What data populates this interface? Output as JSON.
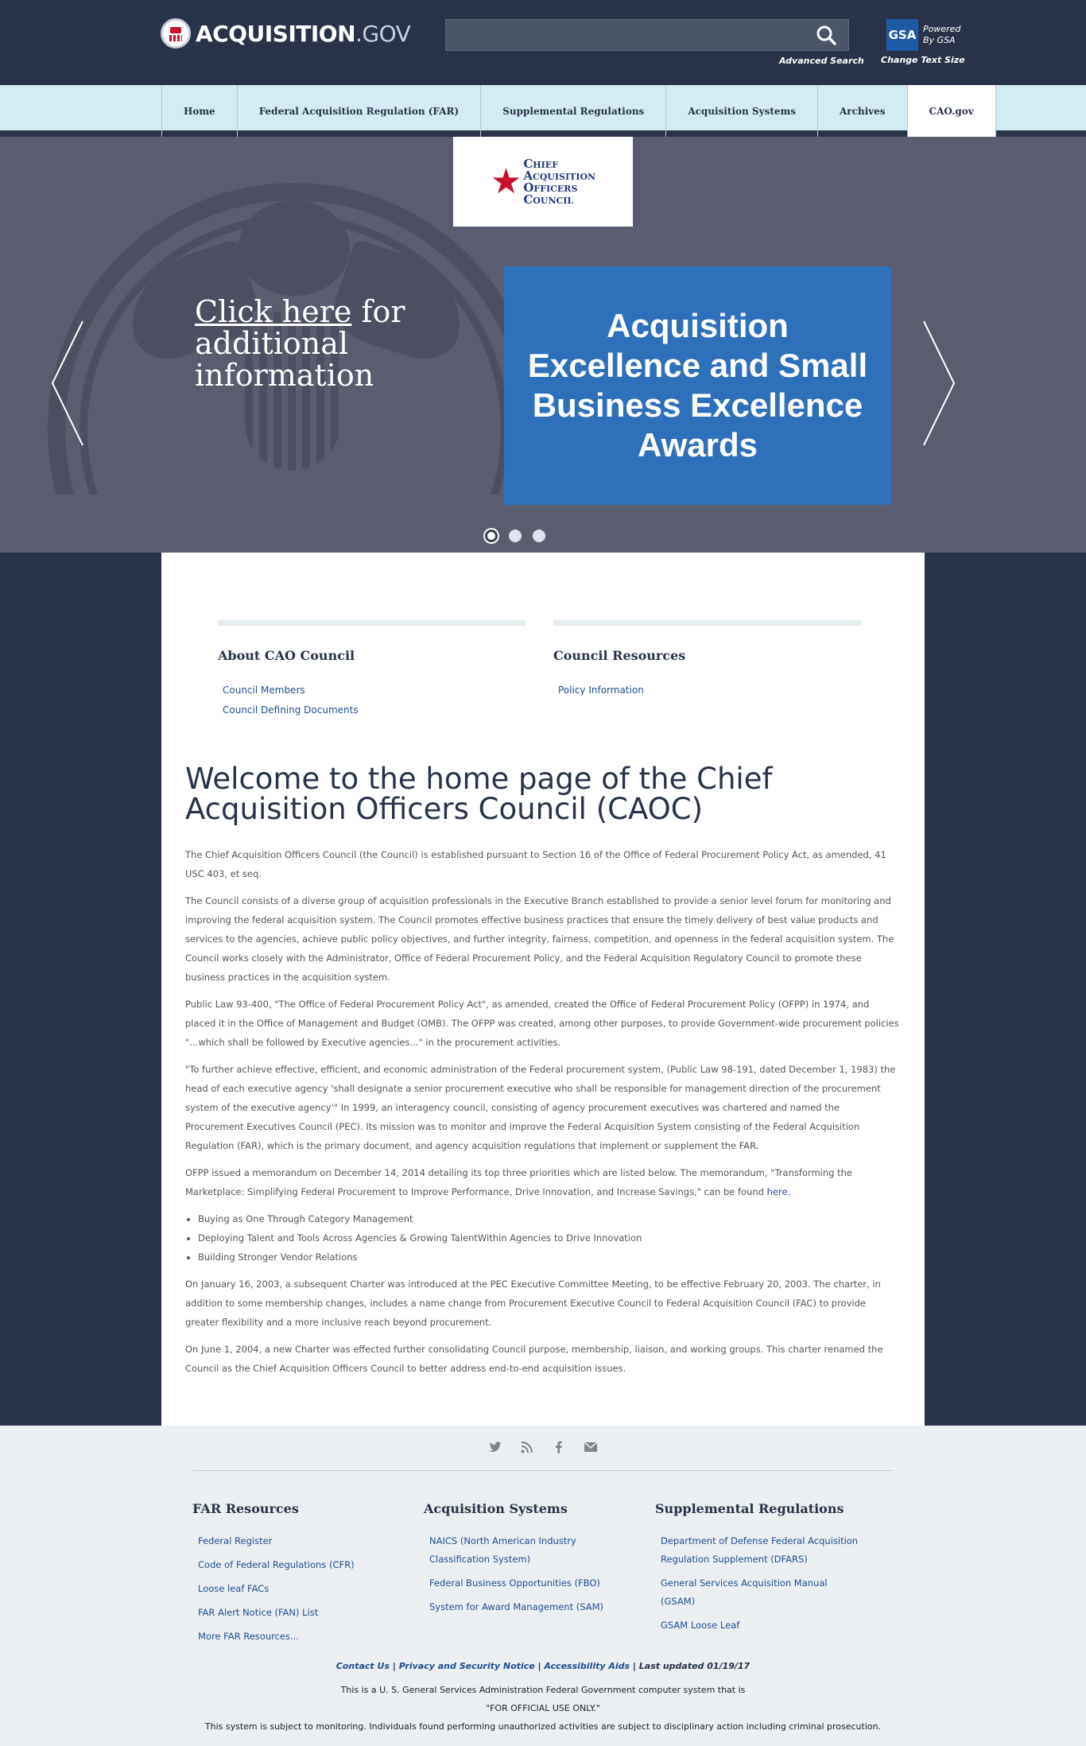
{
  "header": {
    "logo_main": "ACQUISITION",
    "logo_suffix": ".GOV",
    "search_placeholder": "",
    "advanced_search": "Advanced Search",
    "gsa_logo": "GSA",
    "powered_line1": "Powered",
    "powered_line2": "By GSA",
    "change_text_size": "Change Text Size"
  },
  "nav": {
    "items": [
      {
        "label": "Home"
      },
      {
        "label": "Federal Acquisition Regulation (FAR)"
      },
      {
        "label": "Supplemental Regulations"
      },
      {
        "label": "Acquisition Systems"
      },
      {
        "label": "Archives"
      },
      {
        "label": "CAO.gov"
      }
    ],
    "active": "CAO.gov"
  },
  "hero": {
    "cao_logo": {
      "line1": "Chief",
      "line2": "Acquisition",
      "line3": "Officers",
      "line4": "Council"
    },
    "link_text": "Click here",
    "link_rest": " for additional information",
    "award_text": "Acquisition Excellence and Small Business Excellence Awards",
    "slides_total": 3,
    "active_slide": 1
  },
  "resources": {
    "about": {
      "title": "About CAO Council",
      "links": [
        "Council Members",
        "Council Defining Documents"
      ]
    },
    "council": {
      "title": "Council Resources",
      "links": [
        "Policy Information"
      ]
    }
  },
  "content": {
    "heading": "Welcome to the home page of the Chief Acquisition Officers Council (CAOC)",
    "p1": "The Chief Acquisition Officers Council (the Council) is established pursuant to Section 16 of the Office of Federal Procurement Policy Act, as amended, 41 USC 403, et seq.",
    "p2": "The Council consists of a diverse group of acquisition professionals in the Executive Branch established to provide a senior level forum for monitoring and improving the federal acquisition system. The Council promotes effective business practices that ensure the timely delivery of best value products and services to the agencies, achieve public policy objectives, and further integrity, fairness, competition, and openness in the federal acquisition system. The Council works closely with the Administrator, Office of Federal Procurement Policy, and the Federal Acquisition Regulatory Council to promote these business practices in the acquisition system.",
    "p3": "Public Law 93-400, \"The Office of Federal Procurement Policy Act\", as amended, created the Office of Federal Procurement Policy (OFPP) in 1974, and placed it in the Office of Management and Budget (OMB). The OFPP was created, among other purposes, to provide Government-wide procurement policies \"...which shall be followed by Executive agencies...\" in the procurement activities.",
    "p4": "\"To further achieve effective, efficient, and economic administration of the Federal procurement system, (Public Law 98-191, dated December 1, 1983) the head of each executive agency 'shall designate a senior procurement executive who shall be responsible for management direction of the procurement system of the executive agency'\" In 1999, an interagency council, consisting of agency procurement executives was chartered and named the Procurement Executives Council (PEC). Its mission was to monitor and improve the Federal Acquisition System consisting of the Federal Acquisition Regulation (FAR), which is the primary document, and agency acquisition regulations that implement or supplement the FAR.",
    "p5": "OFPP issued a memorandum on December 14, 2014 detailing its top three priorities which are listed below. The memorandum, \"Transforming the Marketplace: Simplifying Federal Procurement to Improve Performance, Drive Innovation, and Increase Savings,\" can be found ",
    "p5_link": "here.",
    "bullets": [
      "Buying as One Through Category Management",
      "Deploying Talent and Tools Across Agencies & Growing TalentWithin Agencies to Drive Innovation",
      "Building Stronger Vendor Relations"
    ],
    "p6": "On January 16, 2003, a subsequent Charter was introduced at the PEC Executive Committee Meeting, to be effective February 20, 2003. The charter, in addition to some membership changes, includes a name change from Procurement Executive Council to Federal Acquisition Council (FAC) to provide greater flexibility and a more inclusive reach beyond procurement.",
    "p7": "On June 1, 2004, a new Charter was effected further consolidating Council purpose, membership, liaison, and working groups. This charter renamed the Council as the Chief Acquisition Officers Council to better address end-to-end acquisition issues."
  },
  "footer": {
    "social": [
      "twitter-icon",
      "rss-icon",
      "facebook-icon",
      "email-icon"
    ],
    "far": {
      "title": "FAR Resources",
      "links": [
        "Federal Register",
        "Code of Federal Regulations (CFR)",
        "Loose leaf FACs",
        "FAR Alert Notice (FAN) List",
        "More FAR Resources..."
      ]
    },
    "systems": {
      "title": "Acquisition Systems",
      "links": [
        "NAICS (North American Industry Classification System)",
        "Federal Business Opportunities (FBO)",
        "System for Award Management (SAM)"
      ]
    },
    "supplemental": {
      "title": "Supplemental Regulations",
      "links": [
        "Department of Defense Federal Acquisition Regulation Supplement (DFARS)",
        "General Services Acquisition Manual (GSAM)",
        "GSAM Loose Leaf"
      ]
    },
    "contact": "Contact Us",
    "privacy": "Privacy and Security Notice",
    "accessibility": "Accessibility Aids",
    "updated": "Last updated 01/19/17",
    "notice1": "This is a U. S. General Services Administration Federal Government computer system that is",
    "notice2": "\"FOR OFFICIAL USE ONLY.\"",
    "notice3": "This system is subject to monitoring. Individuals found performing unauthorized activities are subject to disciplinary action including criminal prosecution."
  }
}
